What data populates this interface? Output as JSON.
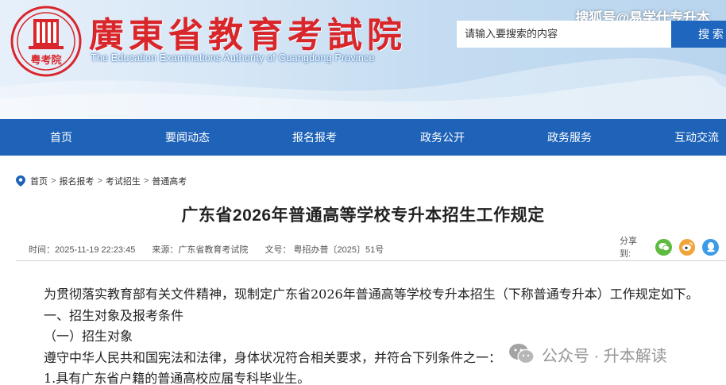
{
  "header": {
    "site_title": "廣東省教育考試院",
    "site_subtitle": "The Education Examinations Authority of Guangdong Province",
    "logo_text": "粤考院",
    "watermark_top": "搜狐号@易学仕专升本",
    "search": {
      "placeholder": "请输入要搜索的内容",
      "button_label": "搜 索"
    }
  },
  "nav": {
    "items": [
      {
        "label": "首页"
      },
      {
        "label": "要闻动态"
      },
      {
        "label": "报名报考"
      },
      {
        "label": "政务公开"
      },
      {
        "label": "政务服务"
      },
      {
        "label": "互动交流"
      }
    ]
  },
  "breadcrumb": {
    "items": [
      "首页",
      "报名报考",
      "考试招生",
      "普通高考"
    ],
    "separator": ">"
  },
  "article": {
    "title": "广东省2026年普通高等学校专升本招生工作规定",
    "meta": {
      "time": "时间：2025-11-19 22:23:45",
      "source": "来源：广东省教育考试院",
      "doc_no": "文号： 粤招办普〔2025〕51号"
    },
    "share_label": "分享到:",
    "share_icons": [
      "wechat-icon",
      "weibo-icon",
      "qq-icon"
    ],
    "paragraphs": [
      "为贯彻落实教育部有关文件精神，现制定广东省2026年普通高等学校专升本招生（下称普通专升本）工作规定如下。",
      "一、招生对象及报考条件",
      "（一）招生对象",
      "遵守中华人民共和国宪法和法律，身体状况符合相关要求，并符合下列条件之一：",
      "1.具有广东省户籍的普通高校应届专科毕业生。"
    ]
  },
  "watermark_bottom": "公众号 · 升本解读",
  "colors": {
    "nav_bg": "#1f63b8",
    "title_red": "#d9262b",
    "search_btn": "#1f66bf"
  }
}
